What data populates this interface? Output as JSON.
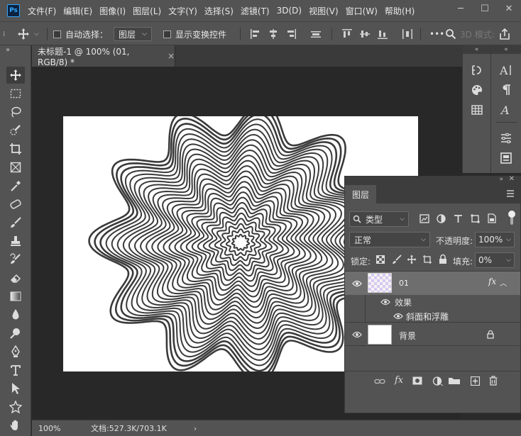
{
  "menu": {
    "logo": "Ps",
    "items": [
      "文件(F)",
      "编辑(E)",
      "图像(I)",
      "图层(L)",
      "文字(Y)",
      "选择(S)",
      "滤镜(T)",
      "3D(D)",
      "视图(V)",
      "窗口(W)",
      "帮助(H)"
    ],
    "window_controls": [
      "─",
      "☐",
      "✕"
    ]
  },
  "options": {
    "auto_select_label": "自动选择：",
    "auto_select_target": "图层",
    "show_transform_label": "显示变换控件",
    "more": "•••",
    "mode_3d": "3D 模式:"
  },
  "document": {
    "tab_title": "未标题-1 @ 100% (01, RGB/8) *",
    "close_glyph": "×"
  },
  "status": {
    "zoom": "100%",
    "doc_info": "文档:527.3K/703.1K",
    "arrow": "›"
  },
  "layers_panel": {
    "tab": "图层",
    "filter_kind": "类型",
    "blend_mode": "正常",
    "opacity_label": "不透明度:",
    "opacity_value": "100%",
    "lock_label": "锁定:",
    "fill_label": "填充:",
    "fill_value": "0%",
    "layers": [
      {
        "name": "01",
        "selected": true,
        "fx": "fx"
      },
      {
        "name": "背景",
        "selected": false,
        "locked": true
      }
    ],
    "effects_label": "效果",
    "effect_name": "斜面和浮雕",
    "bottom_icons": [
      "link-icon",
      "fx-icon",
      "mask-icon",
      "adjustment-icon",
      "group-icon",
      "new-layer-icon",
      "trash-icon"
    ]
  },
  "colors": {
    "ui_panel": "#535353",
    "canvas_bg": "#282828",
    "selected_row": "#6e6e6e",
    "artwork_stroke": "#3a3a3a"
  }
}
